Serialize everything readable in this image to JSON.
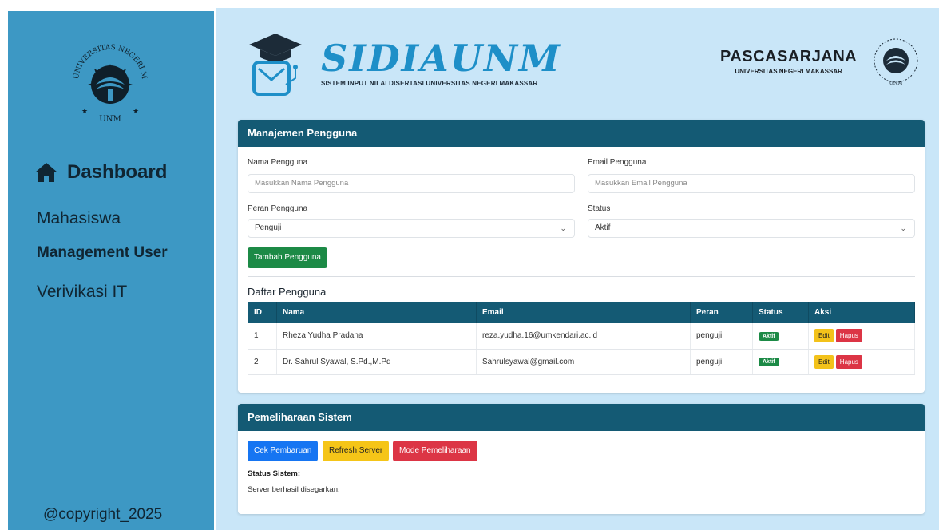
{
  "sidebar": {
    "logo_text": "UNIVERSITAS NEGERI MAKASSAR",
    "logo_sub": "UNM",
    "dashboard": "Dashboard",
    "items": [
      "Mahasiswa",
      "Management User",
      "Verivikasi IT"
    ],
    "copyright": "@copyright_2025"
  },
  "header": {
    "brand_title": "SIDIAUNM",
    "brand_sub": "SISTEM INPUT NILAI DISERTASI UNIVERSITAS NEGERI MAKASSAR",
    "pasca_title": "PASCASARJANA",
    "pasca_sub": "UNIVERSITAS NEGERI MAKASSAR"
  },
  "user_form": {
    "title": "Manajemen Pengguna",
    "name_label": "Nama Pengguna",
    "name_placeholder": "Masukkan Nama Pengguna",
    "email_label": "Email Pengguna",
    "email_placeholder": "Masukkan Email Pengguna",
    "role_label": "Peran Pengguna",
    "role_value": "Penguji",
    "status_label": "Status",
    "status_value": "Aktif",
    "add_button": "Tambah Pengguna"
  },
  "user_list": {
    "title": "Daftar Pengguna",
    "columns": [
      "ID",
      "Nama",
      "Email",
      "Peran",
      "Status",
      "Aksi"
    ],
    "rows": [
      {
        "id": "1",
        "name": "Rheza Yudha Pradana",
        "email": "reza.yudha.16@umkendari.ac.id",
        "role": "penguji",
        "status": "Aktif"
      },
      {
        "id": "2",
        "name": "Dr. Sahrul Syawal, S.Pd.,M.Pd",
        "email": "Sahrulsyawal@gmail.com",
        "role": "penguji",
        "status": "Aktif"
      }
    ],
    "edit_label": "Edit",
    "delete_label": "Hapus"
  },
  "maintenance": {
    "title": "Pemeliharaan Sistem",
    "check_button": "Cek Pembaruan",
    "refresh_button": "Refresh Server",
    "mode_button": "Mode Pemeliharaan",
    "status_label": "Status Sistem:",
    "status_text": "Server berhasil disegarkan."
  },
  "colors": {
    "sidebar": "#3d98c4",
    "main_bg": "#c9e6f8",
    "header_bar": "#145a74",
    "brand": "#1e8fc8"
  }
}
